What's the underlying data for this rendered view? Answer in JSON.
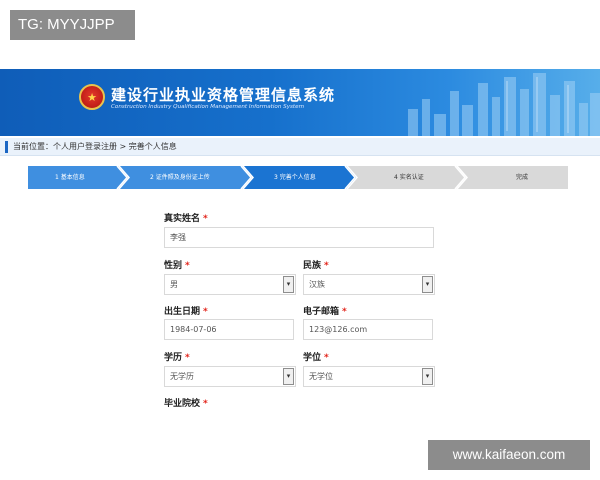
{
  "badge": {
    "text": "TG: MYYJJPP"
  },
  "header": {
    "title": "建设行业执业资格管理信息系统",
    "subtitle": "Construction Industry Qualification Management Information System"
  },
  "breadcrumb": {
    "text": "当前位置：个人用户登录注册 > 完善个人信息"
  },
  "steps": [
    {
      "label": "1 基本信息",
      "state": "done"
    },
    {
      "label": "2 证件照及身份证上传",
      "state": "done"
    },
    {
      "label": "3 完善个人信息",
      "state": "active"
    },
    {
      "label": "4 实名认证",
      "state": "pending"
    },
    {
      "label": "完成",
      "state": "pending"
    }
  ],
  "form": {
    "name": {
      "label": "真实姓名",
      "value": "李强"
    },
    "gender": {
      "label": "性别",
      "value": "男"
    },
    "ethnicity": {
      "label": "民族",
      "value": "汉族"
    },
    "birthdate": {
      "label": "出生日期",
      "value": "1984-07-06"
    },
    "email": {
      "label": "电子邮箱",
      "value": "123@126.com"
    },
    "education": {
      "label": "学历",
      "value": "无学历"
    },
    "degree": {
      "label": "学位",
      "value": "无学位"
    },
    "school": {
      "label": "毕业院校"
    },
    "required_mark": "*"
  },
  "watermark": {
    "text": "www.kaifaeon.com"
  },
  "colors": {
    "banner": "#1670cc",
    "step_active": "#1b74d2",
    "step_done": "#3f8fe0",
    "step_pending": "#d9d9d9",
    "required": "#e2231a"
  }
}
